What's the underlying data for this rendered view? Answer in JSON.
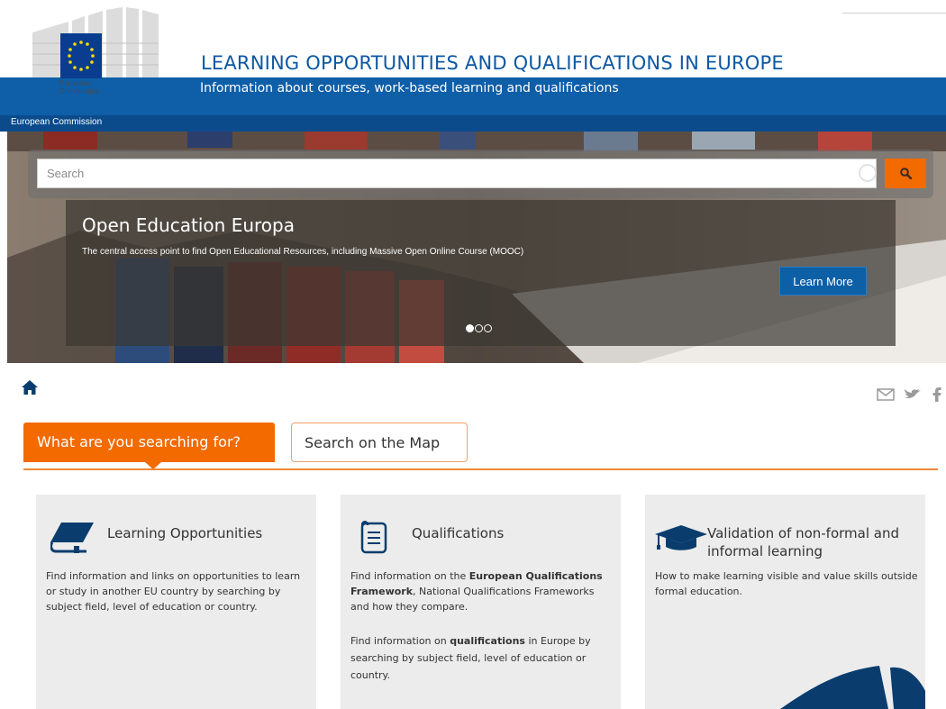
{
  "header": {
    "logo_text": "European\nCommission",
    "title": "LEARNING OPPORTUNITIES AND QUALIFICATIONS IN EUROPE",
    "subtitle": "Information about courses, work-based learning and qualifications",
    "ec_bar_label": "European Commission"
  },
  "search": {
    "placeholder": "Search",
    "button_icon": "search-icon"
  },
  "hero": {
    "title": "Open Education Europa",
    "description": "The central access point to find Open Educational Resources, including Massive Open Online Course (MOOC)",
    "button_label": "Learn More",
    "slides_total": 3,
    "slide_active": 1
  },
  "nav": {
    "home_icon": "home-icon",
    "share_icons": [
      "email-icon",
      "twitter-icon",
      "facebook-icon"
    ]
  },
  "tabs": [
    {
      "label": "What are you searching for?",
      "active": true
    },
    {
      "label": "Search on the Map",
      "active": false
    }
  ],
  "cards": [
    {
      "icon": "book-icon",
      "title": "Learning Opportunities",
      "text": "Find information and links on opportunities to learn or study in another EU country by searching by subject field, level of education or country."
    },
    {
      "icon": "scroll-icon",
      "title": "Qualifications",
      "text1_a": "Find information on the ",
      "text1_b": "European Qualifications Framework",
      "text1_c": ", National Qualifications Frameworks and how they compare.",
      "text2_a": "Find information on ",
      "text2_b": "qualifications",
      "text2_c": " in Europe by searching by subject field, level of education or country."
    },
    {
      "icon": "graduation-cap-icon",
      "title": "Validation of non-formal and informal learning",
      "text": "How to make learning visible and value skills outside formal education."
    }
  ],
  "colors": {
    "brand_blue": "#0e5ea8",
    "accent_orange": "#f26a00",
    "card_bg": "#ececec"
  }
}
